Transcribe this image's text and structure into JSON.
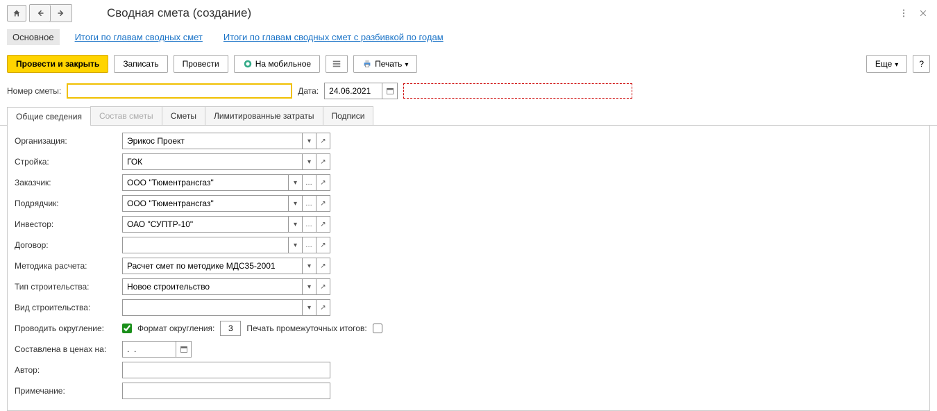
{
  "title": "Сводная смета (создание)",
  "viewTabs": {
    "main": "Основное",
    "link1": "Итоги по главам сводных смет",
    "link2": "Итоги по главам сводных смет с разбивкой по годам"
  },
  "toolbar": {
    "post_close": "Провести и закрыть",
    "save": "Записать",
    "post": "Провести",
    "mobile": "На мобильное",
    "print": "Печать",
    "more": "Еще",
    "help": "?"
  },
  "header": {
    "number_label": "Номер сметы:",
    "number_value": "",
    "date_label": "Дата:",
    "date_value": "24.06.2021"
  },
  "tabs": {
    "t1": "Общие сведения",
    "t2": "Состав сметы",
    "t3": "Сметы",
    "t4": "Лимитированные затраты",
    "t5": "Подписи"
  },
  "fields": {
    "org_label": "Организация:",
    "org_value": "Эрикос Проект",
    "build_label": "Стройка:",
    "build_value": "ГОК",
    "customer_label": "Заказчик:",
    "customer_value": "ООО \"Тюментрансгаз\"",
    "contractor_label": "Подрядчик:",
    "contractor_value": "ООО \"Тюментрансгаз\"",
    "investor_label": "Инвестор:",
    "investor_value": "ОАО \"СУПТР-10\"",
    "contract_label": "Договор:",
    "contract_value": "",
    "method_label": "Методика расчета:",
    "method_value": "Расчет смет по методике МДС35-2001",
    "constr_type_label": "Тип строительства:",
    "constr_type_value": "Новое строительство",
    "constr_kind_label": "Вид строительства:",
    "constr_kind_value": "",
    "round_label": "Проводить округление:",
    "round_fmt_label": "Формат округления:",
    "round_fmt_value": "3",
    "print_sub_label": "Печать промежуточных итогов:",
    "prices_label": "Составлена в ценах на:",
    "prices_value": ".  .",
    "author_label": "Автор:",
    "author_value": "",
    "note_label": "Примечание:",
    "note_value": ""
  }
}
